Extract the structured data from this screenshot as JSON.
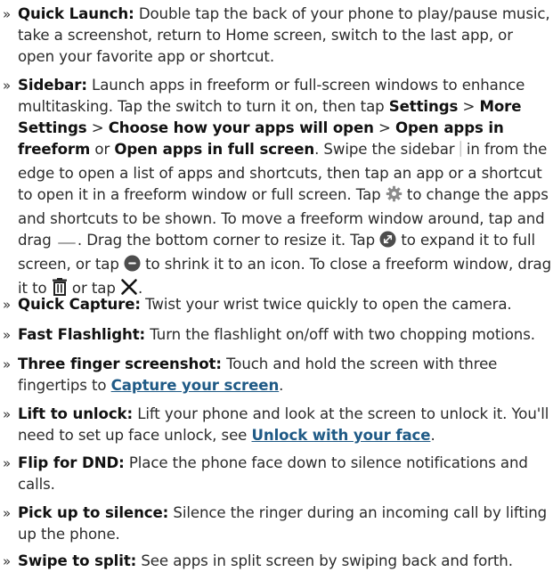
{
  "items": [
    {
      "title": "Quick Launch:",
      "text": " Double tap the back of your phone to play/pause music, take a screenshot, return to Home screen, switch to the last app, or open your favorite app or shortcut."
    },
    {
      "title": "Sidebar:",
      "t1": " Launch apps in freeform or full-screen windows to enhance multitasking. Tap the switch to turn it on, then tap ",
      "b1": "Settings",
      "sep1": " > ",
      "b2": "More Settings",
      "sep2": " > ",
      "b3": "Choose how your apps will open",
      "sep3": " > ",
      "b4": "Open apps in freeform",
      "or1": " or ",
      "b5": "Open apps in full screen",
      "t2": ". Swipe the sidebar ",
      "t3": " in from the edge to open a list of apps and shortcuts, then tap an app or a shortcut to open it in a freeform window or full screen. Tap ",
      "t4": " to change the apps and shortcuts to be shown. To move a freeform window around, tap and drag ",
      "t5": ". Drag the bottom corner to resize it. Tap ",
      "t6": " to expand it to full screen, or tap ",
      "t7": " to shrink it to an icon. To close a freeform window, drag it to ",
      "t8": " or tap ",
      "t9": "."
    },
    {
      "title": "Quick Capture:",
      "text": " Twist your wrist twice quickly to open the camera."
    },
    {
      "title": "Fast Flashlight:",
      "text": " Turn the flashlight on/off with two chopping motions."
    },
    {
      "title": "Three finger screenshot:",
      "text": " Touch and hold the screen with three fingertips to ",
      "link": "Capture your screen",
      "end": "."
    },
    {
      "title": "Lift to unlock:",
      "text": " Lift your phone and look at the screen to unlock it. You'll need to set up face unlock, see ",
      "link": "Unlock with your face",
      "end": "."
    },
    {
      "title": "Flip for DND:",
      "text": " Place the phone face down to silence notifications and calls."
    },
    {
      "title": "Pick up to silence:",
      "text": " Silence the ringer during an incoming call by lifting up the phone."
    },
    {
      "title": "Swipe to split:",
      "text": " See apps in split screen by swiping back and forth."
    }
  ],
  "bullet": "»",
  "colors": {
    "text": "#2b2b2b",
    "link": "#1f5a86",
    "icon": "#4d4d4d"
  }
}
